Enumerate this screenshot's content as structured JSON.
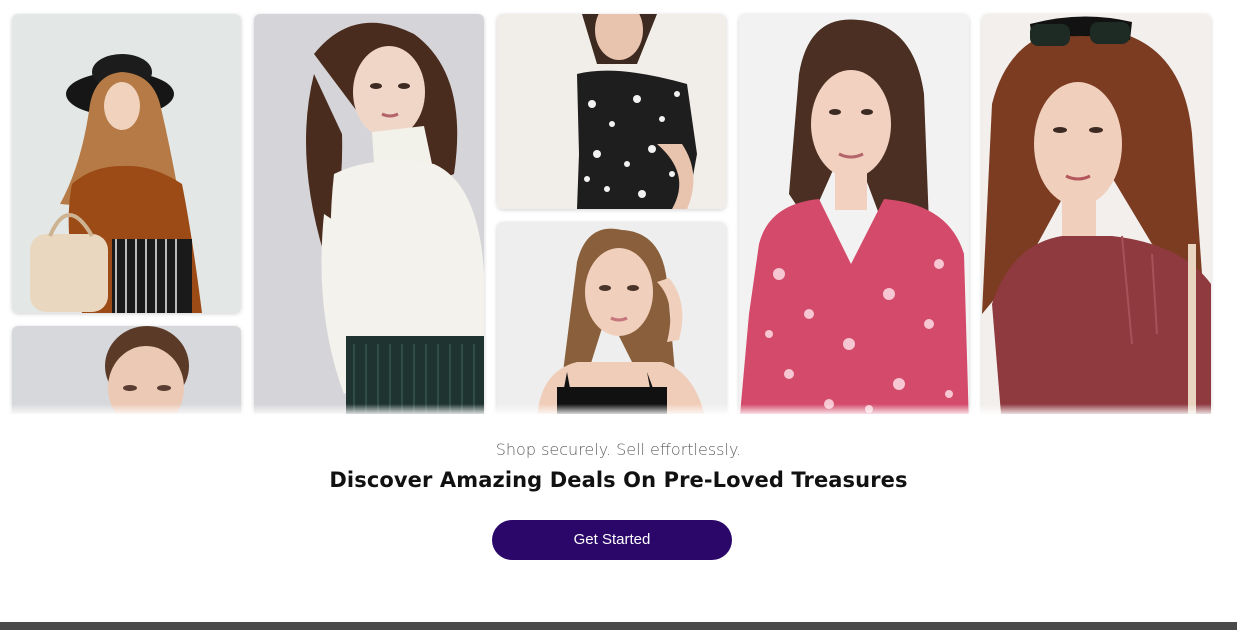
{
  "hero": {
    "tagline": "Shop securely. Sell effortlessly.",
    "headline": "Discover Amazing Deals On Pre-Loved Treasures",
    "cta_label": "Get Started"
  },
  "gallery": {
    "photos": [
      {
        "name": "photo-hijab-woman",
        "bg": "#e6ebe8"
      },
      {
        "name": "photo-woman-bun",
        "bg": "#d7d8db"
      },
      {
        "name": "photo-white-turtleneck",
        "bg": "#d5d5d9"
      },
      {
        "name": "photo-floral-top",
        "bg": "#f1eeea"
      },
      {
        "name": "photo-black-camisole",
        "bg": "#eeeeee"
      },
      {
        "name": "photo-pink-floral-dress",
        "bg": "#f3f2f2"
      },
      {
        "name": "photo-maroon-hoodie",
        "bg": "#f2efec"
      }
    ]
  },
  "colors": {
    "cta_background": "#2b0769",
    "cta_text": "#ffffff",
    "headline": "#111111",
    "tagline": "#5f5f5f"
  }
}
